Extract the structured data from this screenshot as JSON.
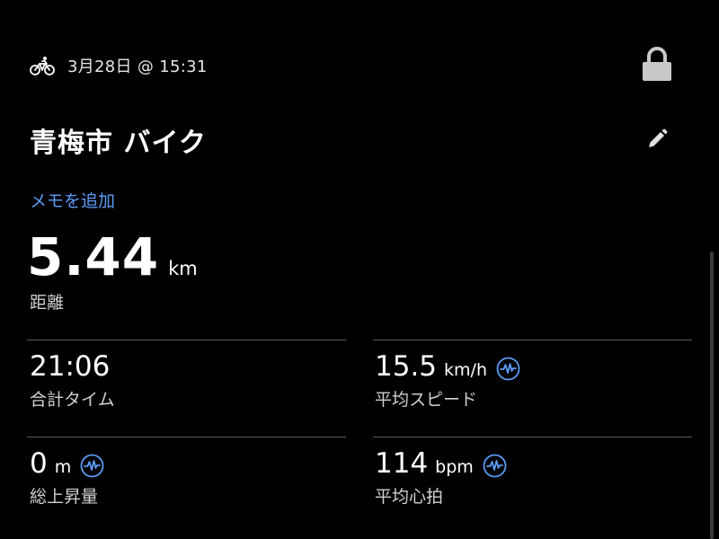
{
  "header": {
    "activity_icon": "bicycle-icon",
    "datetime": "3月28日 @ 15:31",
    "lock_icon": "lock-icon"
  },
  "activity": {
    "title": "青梅市 バイク",
    "edit_icon": "pencil-icon",
    "add_memo_label": "メモを追加"
  },
  "distance": {
    "value": "5.44",
    "unit": "km",
    "label": "距離"
  },
  "stats": {
    "total_time": {
      "value": "21:06",
      "unit": "",
      "label": "合計タイム"
    },
    "avg_speed": {
      "value": "15.5",
      "unit": "km/h",
      "label": "平均スピード",
      "icon": "activity-wave-icon"
    },
    "elevation_gain": {
      "value": "0",
      "unit": "m",
      "label": "総上昇量",
      "icon": "activity-wave-icon"
    },
    "avg_heart_rate": {
      "value": "114",
      "unit": "bpm",
      "label": "平均心拍",
      "icon": "activity-wave-icon"
    }
  },
  "colors": {
    "background": "#000000",
    "accent": "#5b9cf5",
    "text": "#ffffff",
    "secondary_text": "#d0d0d0",
    "divider": "#5a5a5a"
  }
}
